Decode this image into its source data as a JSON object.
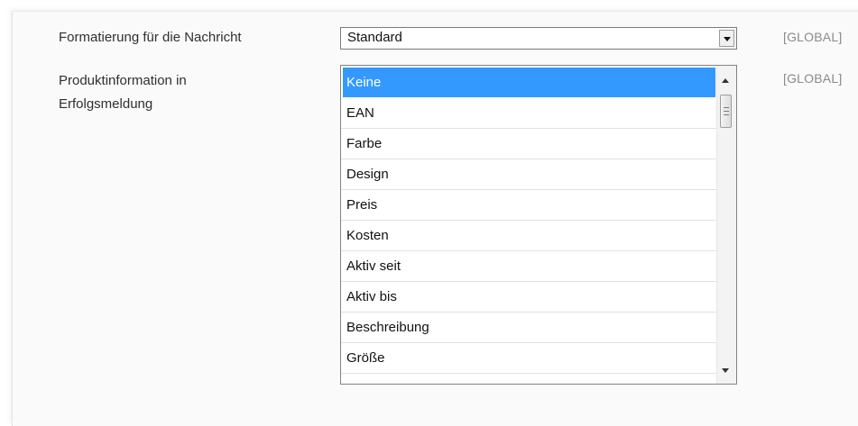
{
  "fields": {
    "format": {
      "label": "Formatierung für die Nachricht",
      "value": "Standard",
      "scope": "[GLOBAL]"
    },
    "product_info": {
      "label_line1": "Produktinformation in",
      "label_line2": "Erfolgsmeldung",
      "scope": "[GLOBAL]",
      "options": [
        "Keine",
        "EAN",
        "Farbe",
        "Design",
        "Preis",
        "Kosten",
        "Aktiv seit",
        "Aktiv bis",
        "Beschreibung",
        "Größe"
      ],
      "selected": "Keine"
    }
  }
}
